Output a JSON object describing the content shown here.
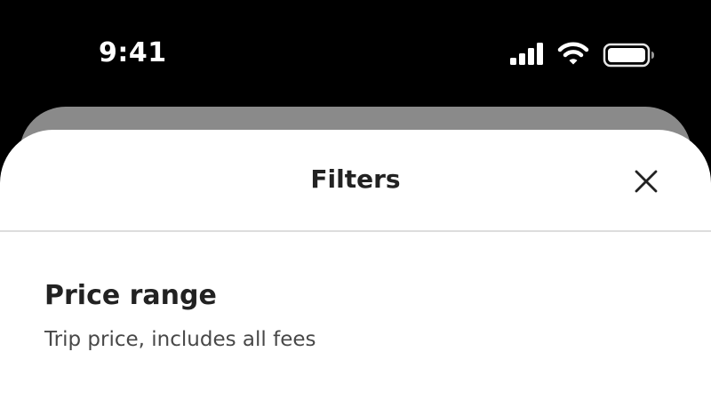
{
  "status_bar": {
    "time": "9:41",
    "icons": [
      "signal-icon",
      "wifi-icon",
      "battery-icon"
    ]
  },
  "modal": {
    "title": "Filters",
    "close_icon": "close-icon"
  },
  "price_section": {
    "title": "Price range",
    "subtitle": "Trip price, includes all fees"
  },
  "colors": {
    "background": "#000000",
    "sheet": "#ffffff",
    "back_sheet": "#8a8a8a",
    "text_primary": "#222222",
    "text_secondary": "#484848",
    "divider": "#dddddd"
  }
}
